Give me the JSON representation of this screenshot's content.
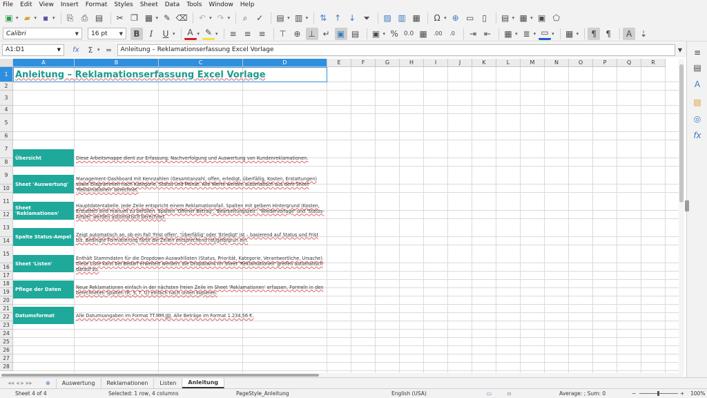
{
  "menu": [
    "File",
    "Edit",
    "View",
    "Insert",
    "Format",
    "Styles",
    "Sheet",
    "Data",
    "Tools",
    "Window",
    "Help"
  ],
  "format": {
    "font_name": "Calibri",
    "font_size": "16 pt"
  },
  "formula_bar": {
    "name_box": "A1:D1",
    "function_icon": "fx",
    "sum_icon": "Σ",
    "equals": "=",
    "content": "Anleitung – Reklamationserfassung Excel Vorlage"
  },
  "columns": [
    "A",
    "B",
    "C",
    "D",
    "E",
    "F",
    "G",
    "H",
    "I",
    "J",
    "K",
    "L",
    "M",
    "N",
    "O",
    "P",
    "Q",
    "R"
  ],
  "rows": [
    "1",
    "2",
    "3",
    "4",
    "5",
    "6",
    "7",
    "8",
    "9",
    "10",
    "11",
    "12",
    "13",
    "14",
    "15",
    "16",
    "17",
    "18",
    "19",
    "20",
    "21",
    "22",
    "23",
    "24",
    "25",
    "26",
    "27",
    "28"
  ],
  "sheet": {
    "title": "Anleitung – Reklamationserfassung Excel Vorlage",
    "sections": [
      {
        "label": "Übersicht",
        "text": "Diese Arbeitsmappe dient zur Erfassung, Nachverfolgung und Auswertung von Kundenreklamationen."
      },
      {
        "label": "Sheet 'Auswertung'",
        "text": "Management-Dashboard mit Kennzahlen (Gesamtanzahl, offen, erledigt, überfällig, Kosten, Erstattungen) sowie Diagrammen nach Kategorie, Status und Monat. Alle Werte werden automatisch aus dem Sheet 'Reklamationen' berechnet."
      },
      {
        "label": "Sheet 'Reklamationen'",
        "text": "Hauptdatentabelle. Jede Zeile entspricht einem Reklamationsfall. Spalten mit gelbem Hintergrund (Kosten, Erstattet) sind manuell zu befüllen. Spalten 'Offener Betrag', 'Bearbeitungszeit', 'Wiedervorlage' und 'Status-Ampel' werden automatisch berechnet."
      },
      {
        "label": "Spalte Status-Ampel",
        "text": "Zeigt automatisch an, ob ein Fall 'Frist offen', 'Überfällig' oder 'Erledigt' ist – basierend auf Status und Frist bis. Bedingte Formatierung färbt die Zeilen entsprechend rot/gelb/grün ein."
      },
      {
        "label": "Sheet 'Listen'",
        "text": "Enthält Stammdaten für die Dropdown-Auswahllisten (Status, Priorität, Kategorie, Verantwortliche, Ursache). Diese Liste kann bei Bedarf erweitert werden; die Dropdowns im Sheet 'Reklamationen' greifen automatisch darauf zu."
      },
      {
        "label": "Pflege der Daten",
        "text": "Neue Reklamationen einfach in der nächsten freien Zeile im Sheet 'Reklamationen' erfassen. Formeln in den berechneten Spalten (R, S, T, U) einfach nach unten kopieren."
      },
      {
        "label": "Datumsformat",
        "text": "Alle Datumsangaben im Format TT.MM.JJJJ. Alle Beträge im Format 1.234,56 €."
      }
    ]
  },
  "tabs": [
    "Auswertung",
    "Reklamationen",
    "Listen",
    "Anleitung"
  ],
  "status": {
    "sheet": "Sheet 4 of 4",
    "selection": "Selected: 1 row, 4 columns",
    "page_style": "PageStyle_Anleitung",
    "language": "English (USA)",
    "summary": "Average: ; Sum: 0",
    "zoom": "100%",
    "zoom_minus": "−",
    "zoom_plus": "+"
  }
}
